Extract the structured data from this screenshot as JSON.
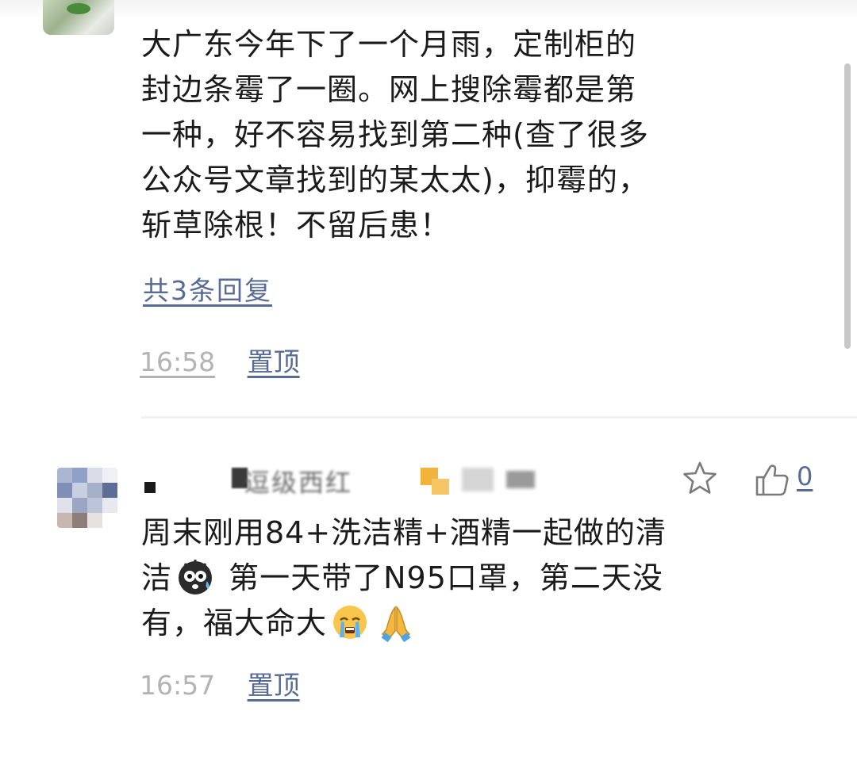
{
  "comment_1": {
    "text": "大广东今年下了一个月雨，定制柜的\n封边条霉了一圈。网上搜除霉都是第\n一种，好不容易找到第二种(查了很多\n公众号文章找到的某太太)，抑霉的，\n斩草除根！不留后患！",
    "replies_label": "共3条回复",
    "time": "16:58",
    "pin_label": "置顶"
  },
  "comment_2": {
    "nickname_visible": "逗级西红",
    "text_line1": "周末刚用84+洗洁精+酒精一起做的清",
    "text_line2_a": "洁",
    "text_line2_b": " 第一天带了N95口罩，第二天没",
    "text_line3": "有，福大命大",
    "time": "16:57",
    "pin_label": "置顶",
    "like_count": "0",
    "emojis": [
      "frightened-sweat-face-emoji",
      "crying-face-emoji",
      "folded-hands-emoji"
    ]
  },
  "colors": {
    "link": "#576b95",
    "timestamp": "#b3b3b3",
    "text": "#1b1b1b"
  },
  "icons": [
    "star-icon",
    "thumbs-up-icon"
  ]
}
